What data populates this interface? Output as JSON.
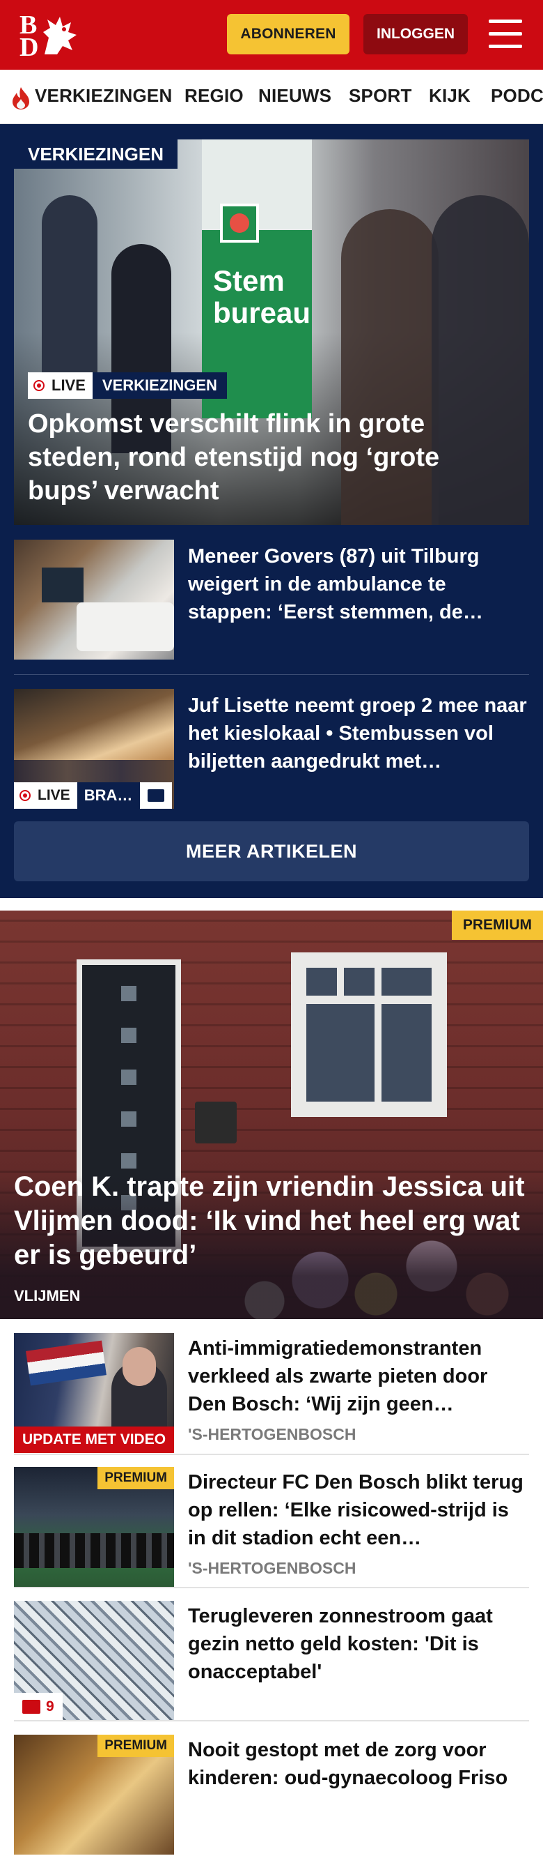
{
  "header": {
    "logo_letters": [
      "B",
      "D"
    ],
    "subscribe_label": "ABONNEREN",
    "login_label": "INLOGGEN",
    "brand_color": "#cc0a12"
  },
  "nav": {
    "items": [
      "VERKIEZINGEN",
      "REGIO",
      "NIEUWS",
      "SPORT",
      "KIJK",
      "PODC"
    ]
  },
  "verkiezingen": {
    "section_label": "VERKIEZINGEN",
    "hero": {
      "live_label": "LIVE",
      "category": "VERKIEZINGEN",
      "title": "Opkomst verschilt flink in grote steden, rond etenstijd nog ‘grote bups’ verwacht",
      "sign_text": "Stem bureau"
    },
    "articles": [
      {
        "title": "Meneer Govers (87) uit Tilburg weigert in de ambulance te stappen: ‘Eerst stemmen, de…"
      },
      {
        "title": "Juf Lisette neemt groep 2 mee naar het kieslokaal • Stembussen vol biljetten aangedrukt met…",
        "live_label": "LIVE",
        "category": "BRA…"
      }
    ],
    "more_label": "MEER ARTIKELEN"
  },
  "feature": {
    "badge": "PREMIUM",
    "title": "Coen K. trapte zijn vriendin Jessica uit Vlijmen dood: ‘Ik vind het heel erg wat er is gebeurd’",
    "location": "VLIJMEN"
  },
  "list": [
    {
      "title": "Anti-immigratiedemonstranten verkleed als zwarte pieten door Den Bosch: ‘Wij zijn geen…",
      "location": "'S-HERTOGENBOSCH",
      "tag": "UPDATE MET VIDEO"
    },
    {
      "title": "Directeur FC Den Bosch blikt terug op rellen: ‘Elke risicowed-strijd is in dit stadion echt een…",
      "location": "'S-HERTOGENBOSCH",
      "badge": "PREMIUM"
    },
    {
      "title": "Terugleveren zonnestroom gaat gezin netto geld kosten: 'Dit is onacceptabel'",
      "comments": "9"
    },
    {
      "title": "Nooit gestopt met de zorg voor kinderen: oud-gynaecoloog Friso",
      "badge": "PREMIUM"
    }
  ]
}
